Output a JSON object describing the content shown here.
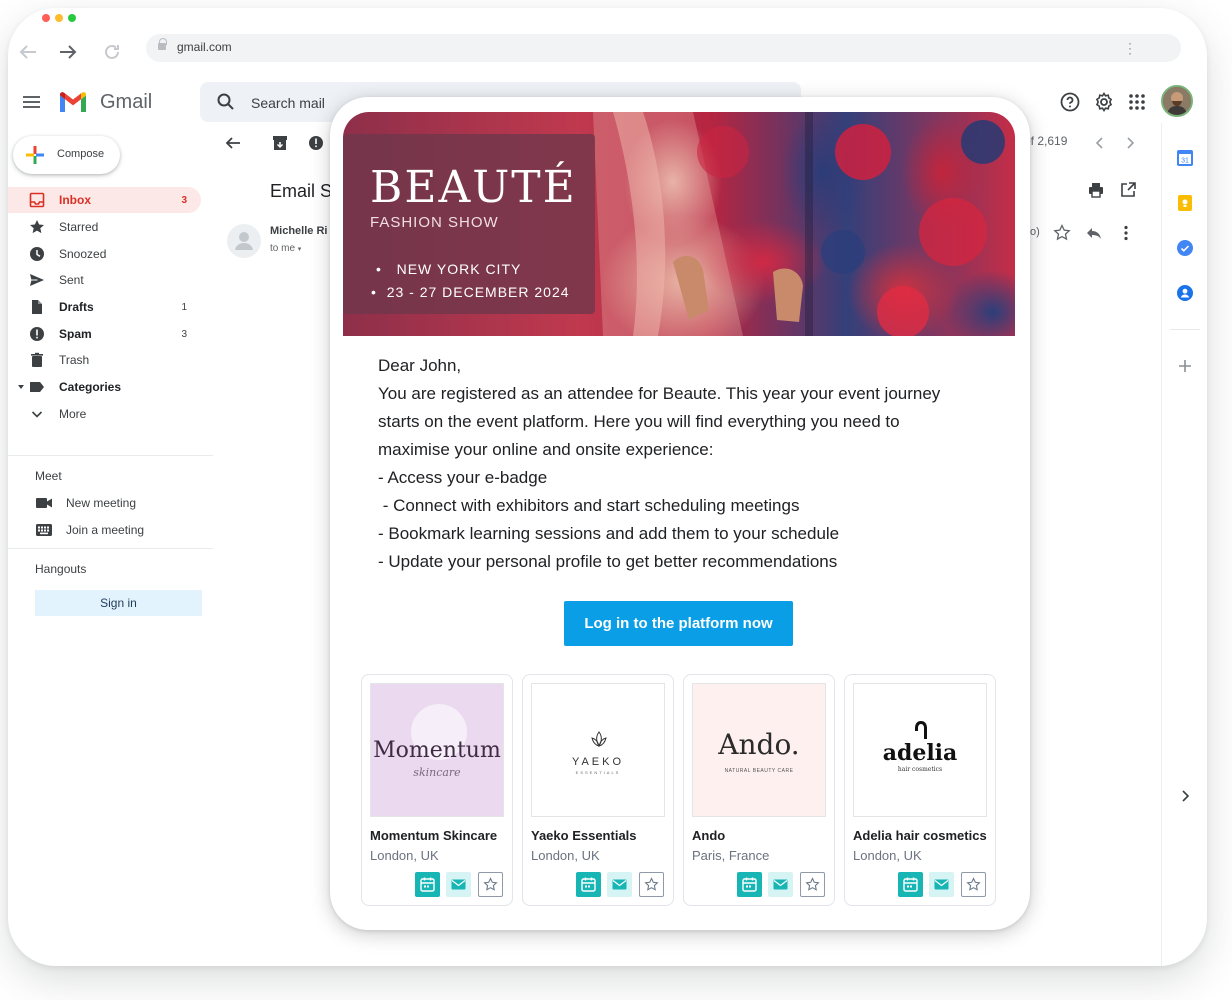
{
  "browser": {
    "url": "gmail.com"
  },
  "gmail": {
    "brand": "Gmail",
    "search_placeholder": "Search mail",
    "compose_label": "Compose",
    "nav": [
      {
        "label": "Inbox",
        "count": "3"
      },
      {
        "label": "Starred",
        "count": ""
      },
      {
        "label": "Snoozed",
        "count": ""
      },
      {
        "label": "Sent",
        "count": ""
      },
      {
        "label": "Drafts",
        "count": "1"
      },
      {
        "label": "Spam",
        "count": "3"
      },
      {
        "label": "Trash",
        "count": ""
      },
      {
        "label": "Categories",
        "count": ""
      },
      {
        "label": "More",
        "count": ""
      }
    ],
    "meet_title": "Meet",
    "meet_items": [
      "New meeting",
      "Join a meeting"
    ],
    "hangouts_title": "Hangouts",
    "signin_label": "Sign in",
    "page_count": "of 2,619",
    "subject": "Email S",
    "sender": "Michelle Ri",
    "to_me": "to me",
    "time_fragment": "o)"
  },
  "email": {
    "hero": {
      "title": "BEAUTÉ",
      "subtitle": "FASHION SHOW",
      "line1": "NEW YORK CITY",
      "line2": "23 - 27 DECEMBER 2024"
    },
    "body_lines": [
      "Dear John,",
      "You are registered as an attendee for Beaute. This year your event journey",
      "starts on the event platform. Here you will find everything you need to",
      "maximise your online and onsite experience:",
      "- Access your e-badge",
      " - Connect with exhibitors and start scheduling meetings",
      "- Bookmark learning sessions and add them to your schedule",
      "- Update your personal profile to get better recommendations"
    ],
    "cta_label": "Log in to the platform now",
    "exhibitors": [
      {
        "name": "Momentum Skincare",
        "location": "London, UK",
        "logo_main": "Momentum",
        "logo_sub": "skincare"
      },
      {
        "name": "Yaeko Essentials",
        "location": "London, UK",
        "logo_main": "YAEKO",
        "logo_sub": "ESSENTIALS"
      },
      {
        "name": "Ando",
        "location": "Paris, France",
        "logo_main": "Ando.",
        "logo_sub": "NATURAL BEAUTY CARE"
      },
      {
        "name": "Adelia hair cosmetics",
        "location": "London, UK",
        "logo_main": "adelia",
        "logo_sub": "hair cosmetics"
      }
    ]
  },
  "colors": {
    "gmail_red": "#d93025",
    "cta_blue": "#0a9ee6",
    "teal": "#18b5b5",
    "teal_light": "#d6f4f4",
    "signin_bg": "#e2f3fe"
  }
}
